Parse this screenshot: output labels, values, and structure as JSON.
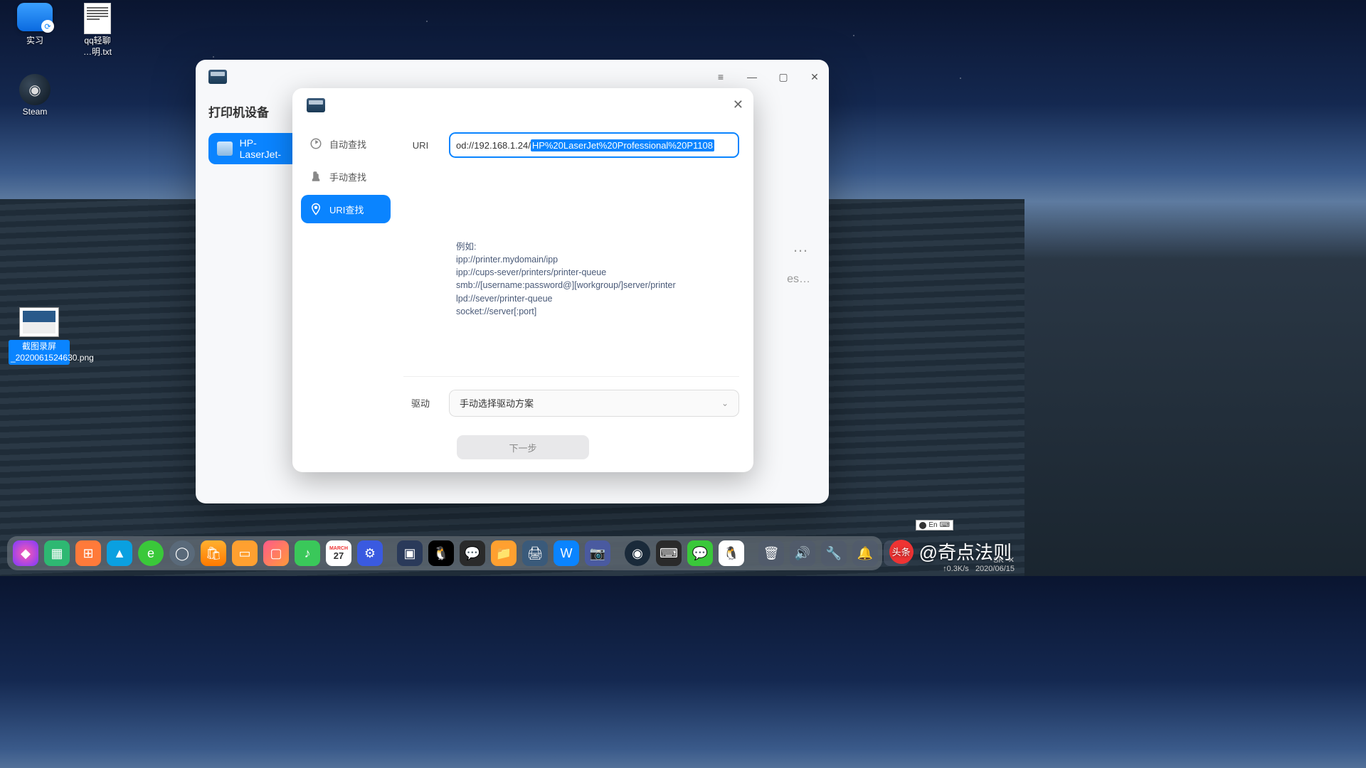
{
  "desktop": {
    "icons": [
      {
        "label": "实习",
        "type": "folder"
      },
      {
        "label": "qq轻聊\n…明.txt",
        "type": "text"
      },
      {
        "label": "Steam",
        "type": "steam"
      }
    ],
    "screenshot_label": "截图录屏_2020061524630.png"
  },
  "window_main": {
    "title": "打印机设备",
    "printer_item": "HP-LaserJet-",
    "right_dots": "…",
    "right_text": "es…"
  },
  "dialog": {
    "sidebar": [
      {
        "label": "自动查找",
        "icon": "auto"
      },
      {
        "label": "手动查找",
        "icon": "manual"
      },
      {
        "label": "URI查找",
        "icon": "uri",
        "active": true
      }
    ],
    "uri_label": "URI",
    "uri_prefix": "od://192.168.1.24/",
    "uri_selected": "HP%20LaserJet%20Professional%20P1108",
    "examples_title": "例如:",
    "examples": [
      "ipp://printer.mydomain/ipp",
      "ipp://cups-sever/printers/printer-queue",
      "smb://[username:password@][workgroup/]server/printer",
      "lpd://sever/printer-queue",
      "socket://server[:port]"
    ],
    "driver_label": "驱动",
    "driver_placeholder": "手动选择驱动方案",
    "next_button": "下一步"
  },
  "dock_groups": [
    [
      "launcher",
      "tasks",
      "grid",
      "store",
      "browser",
      "browser2",
      "bag",
      "appstore",
      "photos",
      "music",
      "calendar",
      "settings"
    ],
    [
      "gamepad",
      "chip",
      "qq",
      "wechat",
      "folder",
      "printer",
      "wps",
      "screenshot"
    ],
    [
      "steam",
      "keyboard",
      "wechat2",
      "qq2"
    ]
  ],
  "tray_icons": [
    "trash",
    "volume",
    "wifi",
    "notify",
    "battery"
  ],
  "tray": {
    "net": "↑0.3K/s",
    "date": "2020/06/15"
  },
  "ime": "En",
  "watermark": {
    "badge": "头条",
    "text": "@奇点法则"
  },
  "calendar_day": "27",
  "colors": {
    "primary": "#0a84ff",
    "dock_cal": "#fff"
  }
}
